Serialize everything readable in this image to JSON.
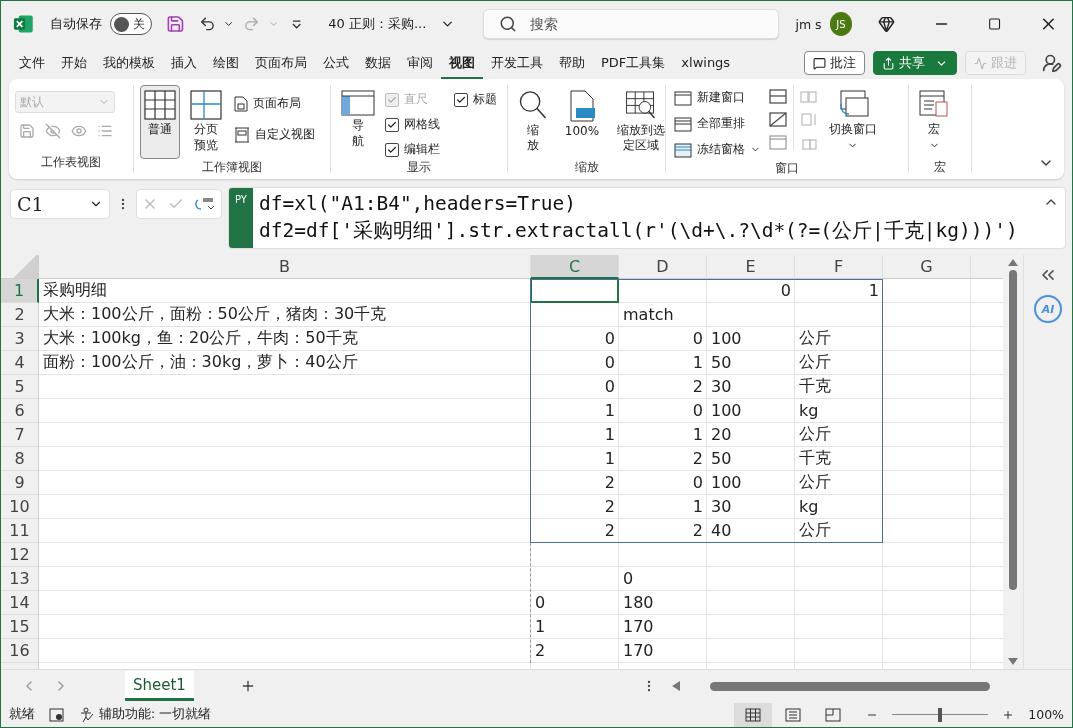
{
  "title_bar": {
    "autosave_label": "自动保存",
    "autosave": {
      "label": "关",
      "on": false
    },
    "document_title": "40 正则：采购...",
    "search_placeholder": "搜索",
    "user_name": "jm s",
    "avatar": "JS"
  },
  "menu_tabs": [
    {
      "label": "文件",
      "selected": false
    },
    {
      "label": "开始",
      "selected": false
    },
    {
      "label": "我的模板",
      "selected": false
    },
    {
      "label": "插入",
      "selected": false
    },
    {
      "label": "绘图",
      "selected": false
    },
    {
      "label": "页面布局",
      "selected": false
    },
    {
      "label": "公式",
      "selected": false
    },
    {
      "label": "数据",
      "selected": false
    },
    {
      "label": "审阅",
      "selected": false
    },
    {
      "label": "视图",
      "selected": true
    },
    {
      "label": "开发工具",
      "selected": false
    },
    {
      "label": "帮助",
      "selected": false
    },
    {
      "label": "PDF工具集",
      "selected": false
    },
    {
      "label": "xlwings",
      "selected": false
    }
  ],
  "menu_actions": [
    {
      "label": "批注",
      "kind": "outline",
      "disabled": false
    },
    {
      "label": "共享",
      "kind": "primary",
      "disabled": false
    },
    {
      "label": "跟进",
      "kind": "outline",
      "disabled": true
    }
  ],
  "ribbon": {
    "sheet_view": {
      "label": "工作表视图",
      "style_value": "默认",
      "disabled": true
    },
    "workbook_view": {
      "label": "工作簿视图",
      "buttons": [
        {
          "label": "普通",
          "selected": true
        },
        {
          "label": "分页预览",
          "selected": false
        }
      ],
      "links": [
        "页面布局",
        "自定义视图"
      ]
    },
    "show": {
      "label": "显示",
      "nav": "导航",
      "checks": [
        {
          "label": "直尺",
          "checked": true,
          "disabled": true
        },
        {
          "label": "网格线",
          "checked": true,
          "disabled": false
        },
        {
          "label": "编辑栏",
          "checked": true,
          "disabled": false
        },
        {
          "label": "标题",
          "checked": true,
          "disabled": false
        }
      ]
    },
    "zoom": {
      "label": "缩放",
      "buttons": [
        "缩放",
        "100%",
        "缩放到选定区域"
      ]
    },
    "window": {
      "label": "窗口",
      "commands": [
        "新建窗口",
        "全部重排",
        "冻结窗格"
      ],
      "switch": "切换窗口"
    },
    "macro": {
      "label": "宏",
      "button": "宏"
    }
  },
  "formula_bar": {
    "name_box": "C1",
    "badge": "PY",
    "lines": [
      "df=xl(\"A1:B4\",headers=True)",
      "df2=df['采购明细'].str.extractall(r'(\\d+\\.?\\d*(?=(公斤|千克|kg)))')"
    ]
  },
  "grid": {
    "columns": {
      "B": {
        "label": "B",
        "selected": false
      },
      "C": {
        "label": "C",
        "selected": true
      },
      "D": {
        "label": "D",
        "selected": false
      },
      "E": {
        "label": "E",
        "selected": false
      },
      "F": {
        "label": "F",
        "selected": false
      },
      "G": {
        "label": "G",
        "selected": false
      }
    },
    "rows": [
      {
        "number": "1",
        "selected": true,
        "cells": {
          "B": {
            "text": "采购明细",
            "kind": "text"
          },
          "E": {
            "text": "0",
            "kind": "number"
          },
          "F": {
            "text": "1",
            "kind": "number"
          }
        }
      },
      {
        "number": "2",
        "selected": false,
        "cells": {
          "B": {
            "text": "大米：100公斤，面粉：50公斤，猪肉：30千克",
            "kind": "text"
          },
          "D": {
            "text": "match",
            "kind": "text"
          }
        }
      },
      {
        "number": "3",
        "selected": false,
        "cells": {
          "B": {
            "text": "大米：100kg，鱼：20公斤，牛肉：50千克",
            "kind": "text"
          },
          "C": {
            "text": "0",
            "kind": "number"
          },
          "D": {
            "text": "0",
            "kind": "number"
          },
          "E": {
            "text": "100",
            "kind": "text"
          },
          "F": {
            "text": "公斤",
            "kind": "text"
          }
        }
      },
      {
        "number": "4",
        "selected": false,
        "cells": {
          "B": {
            "text": "面粉：100公斤，油：30kg，萝卜：40公斤",
            "kind": "text"
          },
          "C": {
            "text": "0",
            "kind": "number"
          },
          "D": {
            "text": "1",
            "kind": "number"
          },
          "E": {
            "text": "50",
            "kind": "text"
          },
          "F": {
            "text": "公斤",
            "kind": "text"
          }
        }
      },
      {
        "number": "5",
        "selected": false,
        "cells": {
          "C": {
            "text": "0",
            "kind": "number"
          },
          "D": {
            "text": "2",
            "kind": "number"
          },
          "E": {
            "text": "30",
            "kind": "text"
          },
          "F": {
            "text": "千克",
            "kind": "text"
          }
        }
      },
      {
        "number": "6",
        "selected": false,
        "cells": {
          "C": {
            "text": "1",
            "kind": "number"
          },
          "D": {
            "text": "0",
            "kind": "number"
          },
          "E": {
            "text": "100",
            "kind": "text"
          },
          "F": {
            "text": "kg",
            "kind": "text"
          }
        }
      },
      {
        "number": "7",
        "selected": false,
        "cells": {
          "C": {
            "text": "1",
            "kind": "number"
          },
          "D": {
            "text": "1",
            "kind": "number"
          },
          "E": {
            "text": "20",
            "kind": "text"
          },
          "F": {
            "text": "公斤",
            "kind": "text"
          }
        }
      },
      {
        "number": "8",
        "selected": false,
        "cells": {
          "C": {
            "text": "1",
            "kind": "number"
          },
          "D": {
            "text": "2",
            "kind": "number"
          },
          "E": {
            "text": "50",
            "kind": "text"
          },
          "F": {
            "text": "千克",
            "kind": "text"
          }
        }
      },
      {
        "number": "9",
        "selected": false,
        "cells": {
          "C": {
            "text": "2",
            "kind": "number"
          },
          "D": {
            "text": "0",
            "kind": "number"
          },
          "E": {
            "text": "100",
            "kind": "text"
          },
          "F": {
            "text": "公斤",
            "kind": "text"
          }
        }
      },
      {
        "number": "10",
        "selected": false,
        "cells": {
          "C": {
            "text": "2",
            "kind": "number"
          },
          "D": {
            "text": "1",
            "kind": "number"
          },
          "E": {
            "text": "30",
            "kind": "text"
          },
          "F": {
            "text": "kg",
            "kind": "text"
          }
        }
      },
      {
        "number": "11",
        "selected": false,
        "cells": {
          "C": {
            "text": "2",
            "kind": "number"
          },
          "D": {
            "text": "2",
            "kind": "number"
          },
          "E": {
            "text": "40",
            "kind": "text"
          },
          "F": {
            "text": "公斤",
            "kind": "text"
          }
        }
      },
      {
        "number": "12",
        "selected": false,
        "cells": {}
      },
      {
        "number": "13",
        "selected": false,
        "cells": {
          "D": {
            "text": "0",
            "kind": "text"
          }
        }
      },
      {
        "number": "14",
        "selected": false,
        "cells": {
          "C": {
            "text": "0",
            "kind": "text"
          },
          "D": {
            "text": "180",
            "kind": "text"
          }
        }
      },
      {
        "number": "15",
        "selected": false,
        "cells": {
          "C": {
            "text": "1",
            "kind": "text"
          },
          "D": {
            "text": "170",
            "kind": "text"
          }
        }
      },
      {
        "number": "16",
        "selected": false,
        "cells": {
          "C": {
            "text": "2",
            "kind": "text"
          },
          "D": {
            "text": "170",
            "kind": "text"
          }
        }
      }
    ]
  },
  "side_panel": {
    "ai_label": "AI"
  },
  "sheet_tabs": [
    {
      "label": "Sheet1",
      "selected": true
    }
  ],
  "status_bar": {
    "ready": "就绪",
    "accessibility": "辅助功能: 一切就绪",
    "views": [
      {
        "selected": true
      },
      {
        "selected": false
      },
      {
        "selected": false
      }
    ],
    "zoom": {
      "level": 0.5,
      "reading": "100%"
    }
  }
}
